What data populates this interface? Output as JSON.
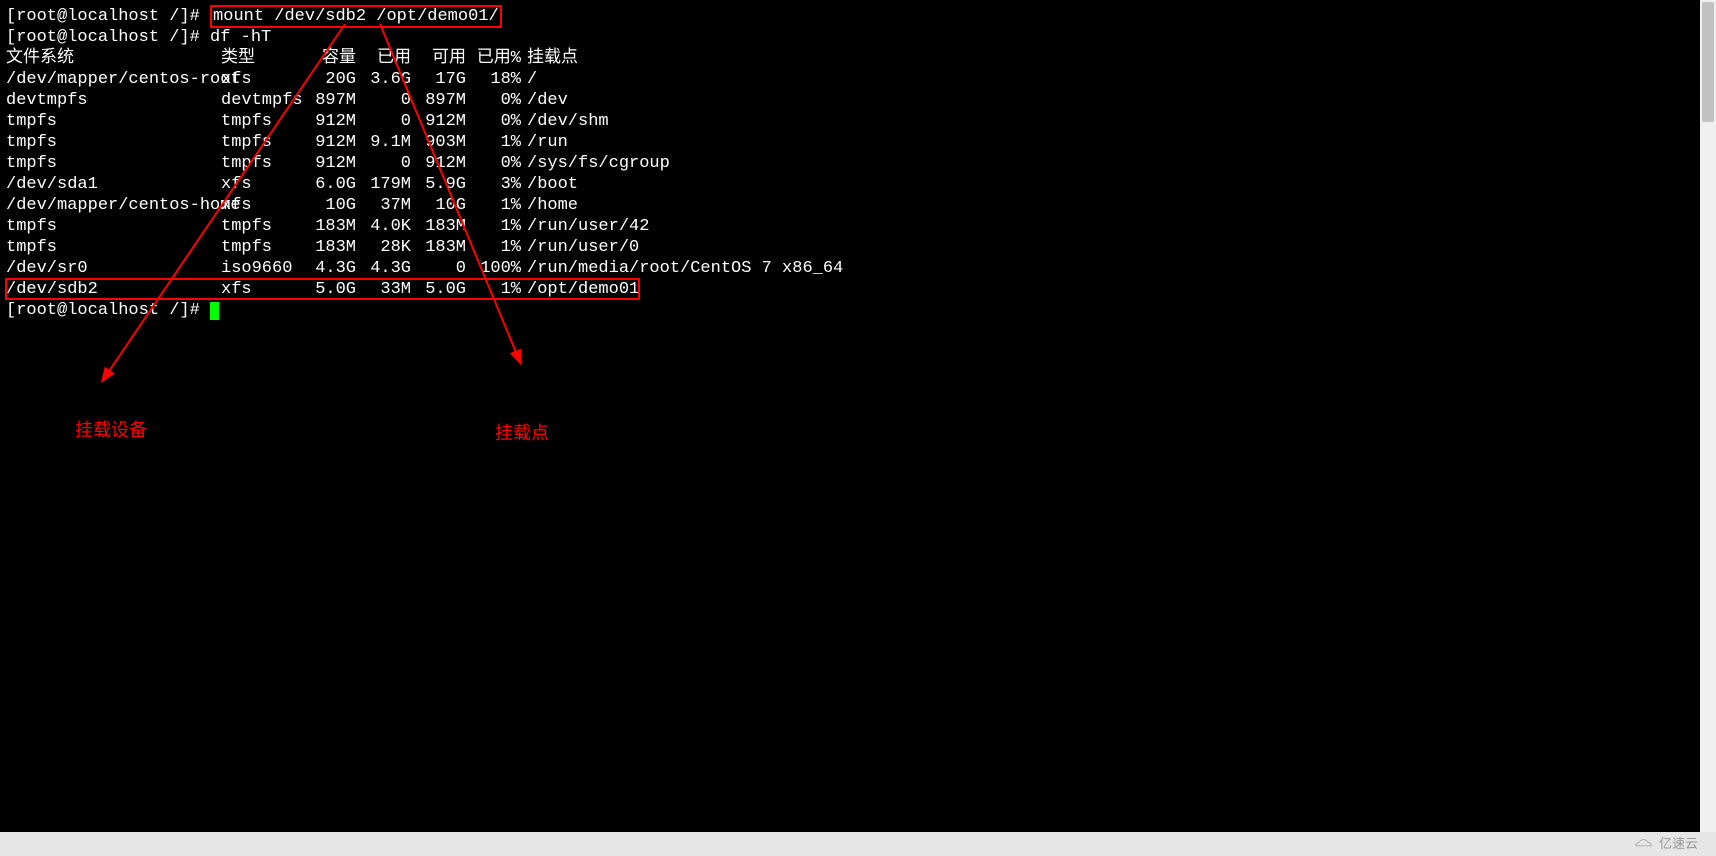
{
  "prompt": "[root@localhost /]# ",
  "cmd_mount": "mount /dev/sdb2 /opt/demo01/",
  "cmd_df": "df -hT",
  "headers": {
    "fs": "文件系统",
    "type": "类型",
    "size": "容量",
    "used": "已用",
    "avail": "可用",
    "pct": "已用%",
    "mnt": "挂载点"
  },
  "rows": [
    {
      "fs": "/dev/mapper/centos-root",
      "type": "xfs",
      "size": "20G",
      "used": "3.6G",
      "avail": "17G",
      "pct": "18%",
      "mnt": "/"
    },
    {
      "fs": "devtmpfs",
      "type": "devtmpfs",
      "size": "897M",
      "used": "0",
      "avail": "897M",
      "pct": "0%",
      "mnt": "/dev"
    },
    {
      "fs": "tmpfs",
      "type": "tmpfs",
      "size": "912M",
      "used": "0",
      "avail": "912M",
      "pct": "0%",
      "mnt": "/dev/shm"
    },
    {
      "fs": "tmpfs",
      "type": "tmpfs",
      "size": "912M",
      "used": "9.1M",
      "avail": "903M",
      "pct": "1%",
      "mnt": "/run"
    },
    {
      "fs": "tmpfs",
      "type": "tmpfs",
      "size": "912M",
      "used": "0",
      "avail": "912M",
      "pct": "0%",
      "mnt": "/sys/fs/cgroup"
    },
    {
      "fs": "/dev/sda1",
      "type": "xfs",
      "size": "6.0G",
      "used": "179M",
      "avail": "5.9G",
      "pct": "3%",
      "mnt": "/boot"
    },
    {
      "fs": "/dev/mapper/centos-home",
      "type": "xfs",
      "size": "10G",
      "used": "37M",
      "avail": "10G",
      "pct": "1%",
      "mnt": "/home"
    },
    {
      "fs": "tmpfs",
      "type": "tmpfs",
      "size": "183M",
      "used": "4.0K",
      "avail": "183M",
      "pct": "1%",
      "mnt": "/run/user/42"
    },
    {
      "fs": "tmpfs",
      "type": "tmpfs",
      "size": "183M",
      "used": "28K",
      "avail": "183M",
      "pct": "1%",
      "mnt": "/run/user/0"
    },
    {
      "fs": "/dev/sr0",
      "type": "iso9660",
      "size": "4.3G",
      "used": "4.3G",
      "avail": "0",
      "pct": "100%",
      "mnt": "/run/media/root/CentOS 7 x86_64"
    },
    {
      "fs": "/dev/sdb2",
      "type": "xfs",
      "size": "5.0G",
      "used": "33M",
      "avail": "5.0G",
      "pct": "1%",
      "mnt": "/opt/demo01"
    }
  ],
  "labels": {
    "device": "挂载设备",
    "mountpoint": "挂载点"
  },
  "watermark": "亿速云"
}
